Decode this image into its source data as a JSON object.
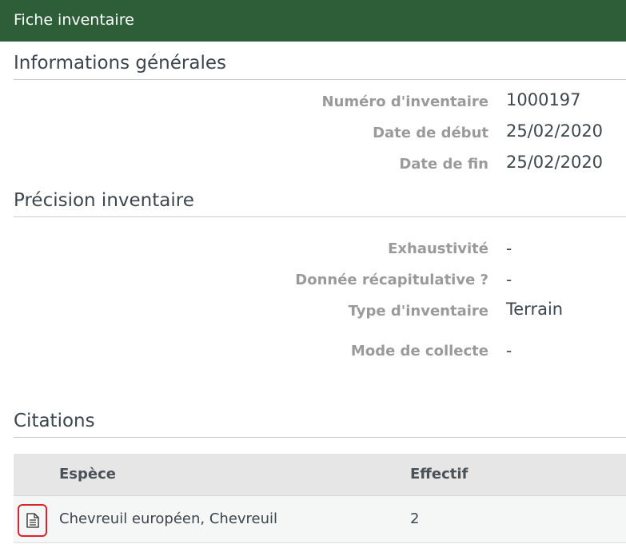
{
  "header": {
    "title": "Fiche inventaire"
  },
  "general": {
    "title": "Informations générales",
    "fields": [
      {
        "label": "Numéro d'inventaire",
        "value": "1000197"
      },
      {
        "label": "Date de début",
        "value": "25/02/2020"
      },
      {
        "label": "Date de fin",
        "value": "25/02/2020"
      }
    ]
  },
  "precision": {
    "title": "Précision inventaire",
    "fields": [
      {
        "label": "Exhaustivité",
        "value": "-"
      },
      {
        "label": "Donnée récapitulative ?",
        "value": "-"
      },
      {
        "label": "Type d'inventaire",
        "value": "Terrain"
      },
      {
        "label": "Mode de collecte",
        "value": "-"
      }
    ]
  },
  "citations": {
    "title": "Citations",
    "columns": {
      "species": "Espèce",
      "count": "Effectif"
    },
    "rows": [
      {
        "species": "Chevreuil européen, Chevreuil",
        "count": "2",
        "icon": "document-icon"
      }
    ]
  },
  "colors": {
    "header_bg": "#2d5e38",
    "highlight": "#d9242b"
  }
}
